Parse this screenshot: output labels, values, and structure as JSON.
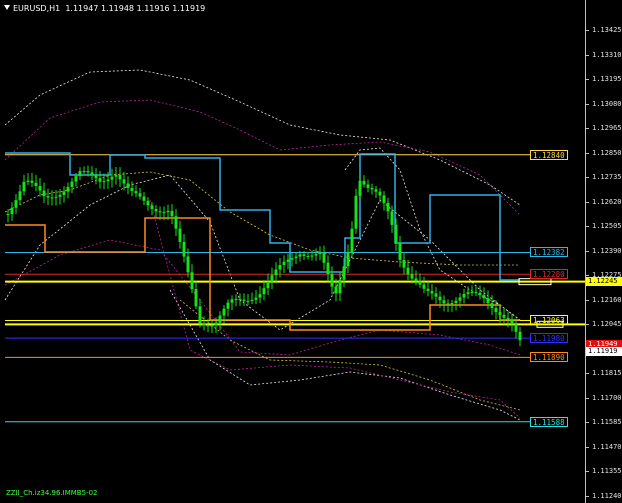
{
  "header": {
    "symbol_timeframe": "EURUSD,H1",
    "quote": "1.11947 1.11948 1.11916 1.11919"
  },
  "price_axis": {
    "ticks": [
      "1.13425",
      "1.13310",
      "1.13195",
      "1.13080",
      "1.12965",
      "1.12850",
      "1.12735",
      "1.12620",
      "1.12505",
      "1.12390",
      "1.12275",
      "1.12160",
      "1.12045",
      "1.11930",
      "1.11815",
      "1.11700",
      "1.11585",
      "1.11470",
      "1.11355",
      "1.11240"
    ],
    "min": 1.1124,
    "max": 1.13425
  },
  "levels": [
    {
      "name": "level-1-12840",
      "price": 1.1284,
      "label": "1.12840",
      "color": "#ffd84a"
    },
    {
      "name": "level-1-12382",
      "price": 1.12382,
      "label": "1.12382",
      "color": "#2db9e8"
    },
    {
      "name": "level-1-12280",
      "price": 1.1228,
      "label": "1.12280",
      "color": "#d62a2a"
    },
    {
      "name": "level-1-12063",
      "price": 1.12063,
      "label": "1.12063",
      "color": "#ffff00"
    },
    {
      "name": "level-1-11980",
      "price": 1.1198,
      "label": "1.11980",
      "color": "#3030ff"
    },
    {
      "name": "level-1-11890",
      "price": 1.1189,
      "label": "1.11890",
      "color": "#ff8a1c"
    },
    {
      "name": "level-1-11588",
      "price": 1.11588,
      "label": "1.11588",
      "color": "#2ae0e0"
    }
  ],
  "axis_tags": [
    {
      "name": "axis-tag-1-12245",
      "price": 1.12245,
      "label": "1.12245",
      "bg": "#ffff00",
      "fg": "#000000"
    },
    {
      "name": "axis-tag-1-11949",
      "price": 1.11949,
      "label": "1.11949",
      "bg": "#e01010",
      "fg": "#ffffff"
    },
    {
      "name": "axis-tag-1-11919",
      "price": 1.11919,
      "label": "1.11919",
      "bg": "#ffffff",
      "fg": "#000000"
    }
  ],
  "colors": {
    "candles": "#19e019",
    "cyan_step": "#30b0e8",
    "orange_step": "#ff8a1c",
    "yellow_line": "#ffff00"
  },
  "bottom_note": "ZZII_Ch.iz34.96.IMMB5-02"
}
